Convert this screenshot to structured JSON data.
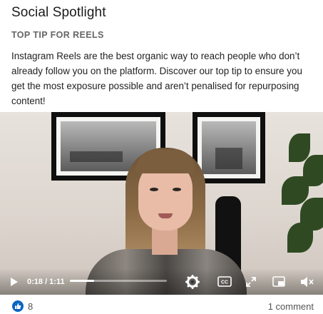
{
  "post": {
    "page_name": "Social Spotlight",
    "heading": "TOP TIP FOR REELS",
    "body": "Instagram Reels are the best organic way to reach people who don’t already follow you on the platform. Discover our top tip to ensure you get the most exposure possible and aren’t penalised for repurposing content!"
  },
  "video": {
    "current_time": "0:18",
    "duration": "1:11",
    "time_display": "0:18 / 1:11",
    "progress": 0.25,
    "controls": {
      "play_icon": "play-icon",
      "settings_icon": "gear-icon",
      "captions_icon": "cc-icon",
      "fullscreen_icon": "expand-icon",
      "pip_icon": "picture-in-picture-icon",
      "volume_icon": "volume-muted-icon"
    }
  },
  "footer": {
    "reaction_icon": "thumbs-up-icon",
    "reaction_count": "8",
    "comments_label": "1 comment"
  },
  "colors": {
    "like_blue": "#0a66c2",
    "heading_gray": "#666666"
  }
}
